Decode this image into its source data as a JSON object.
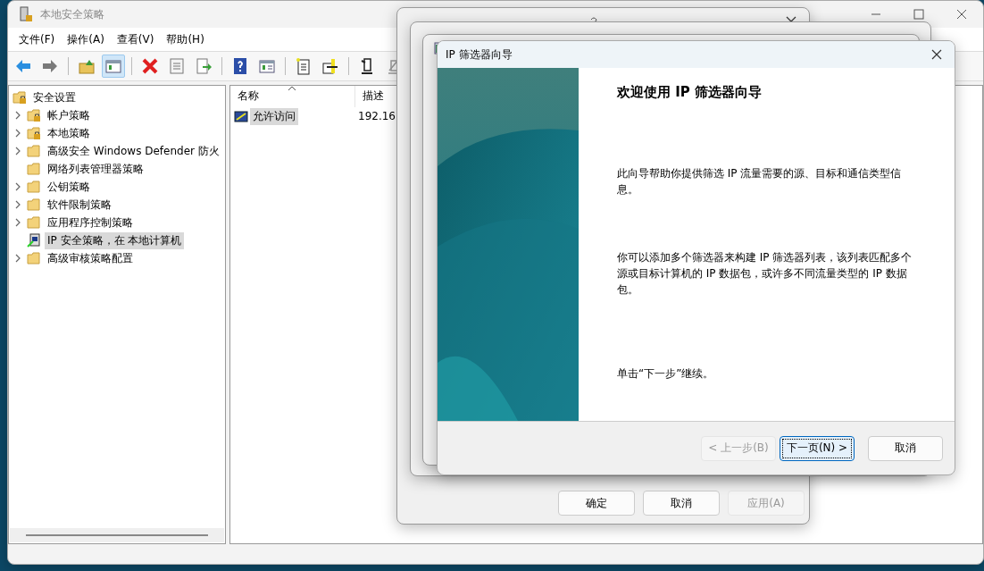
{
  "main_window": {
    "title": "本地安全策略",
    "menu": [
      "文件(F)",
      "操作(A)",
      "查看(V)",
      "帮助(H)"
    ],
    "toolbar": [
      {
        "kind": "back"
      },
      {
        "kind": "forward"
      },
      {
        "kind": "up"
      },
      {
        "kind": "tree",
        "pressed": true
      },
      {
        "kind": "delete"
      },
      {
        "kind": "properties"
      },
      {
        "kind": "export"
      },
      {
        "kind": "help"
      },
      {
        "kind": "view"
      },
      {
        "kind": "new"
      },
      {
        "kind": "add"
      },
      {
        "kind": "assign"
      },
      {
        "kind": "unassign"
      }
    ],
    "tree": {
      "root": "安全设置",
      "items": [
        {
          "label": "帐户策略",
          "kind": "lock-folder",
          "expandable": true,
          "selected": false
        },
        {
          "label": "本地策略",
          "kind": "lock-folder",
          "expandable": true,
          "selected": false
        },
        {
          "label": "高级安全 Windows Defender 防火",
          "kind": "folder",
          "expandable": true,
          "selected": false
        },
        {
          "label": "网络列表管理器策略",
          "kind": "folder",
          "expandable": false,
          "selected": false
        },
        {
          "label": "公钥策略",
          "kind": "folder",
          "expandable": true,
          "selected": false
        },
        {
          "label": "软件限制策略",
          "kind": "folder",
          "expandable": true,
          "selected": false
        },
        {
          "label": "应用程序控制策略",
          "kind": "folder",
          "expandable": true,
          "selected": false
        },
        {
          "label": "IP 安全策略，在 本地计算机",
          "kind": "ip-policy",
          "expandable": false,
          "selected": true
        },
        {
          "label": "高级审核策略配置",
          "kind": "folder",
          "expandable": true,
          "selected": false
        }
      ]
    },
    "list": {
      "columns": [
        "名称",
        "描述"
      ],
      "rows": [
        {
          "name": "允许访问",
          "description": "192.16",
          "selected": true
        }
      ]
    }
  },
  "properties_dialog": {
    "buttons": [
      {
        "label": "确定",
        "disabled": false
      },
      {
        "label": "取消",
        "disabled": false
      },
      {
        "label": "应用(A)",
        "disabled": true
      }
    ]
  },
  "wizard": {
    "title": "IP 筛选器向导",
    "heading": "欢迎使用 IP 筛选器向导",
    "paragraphs": [
      "此向导帮助你提供筛选 IP 流量需要的源、目标和通信类型信息。",
      "你可以添加多个筛选器来构建 IP 筛选器列表，该列表匹配多个源或目标计算机的 IP 数据包，或许多不同流量类型的 IP 数据包。",
      "单击“下一步”继续。"
    ],
    "buttons": [
      {
        "label": "< 上一步(B)",
        "disabled": true,
        "default": false
      },
      {
        "label": "下一页(N) >",
        "disabled": false,
        "default": true
      },
      {
        "label": "取消",
        "disabled": false,
        "default": false
      }
    ]
  }
}
